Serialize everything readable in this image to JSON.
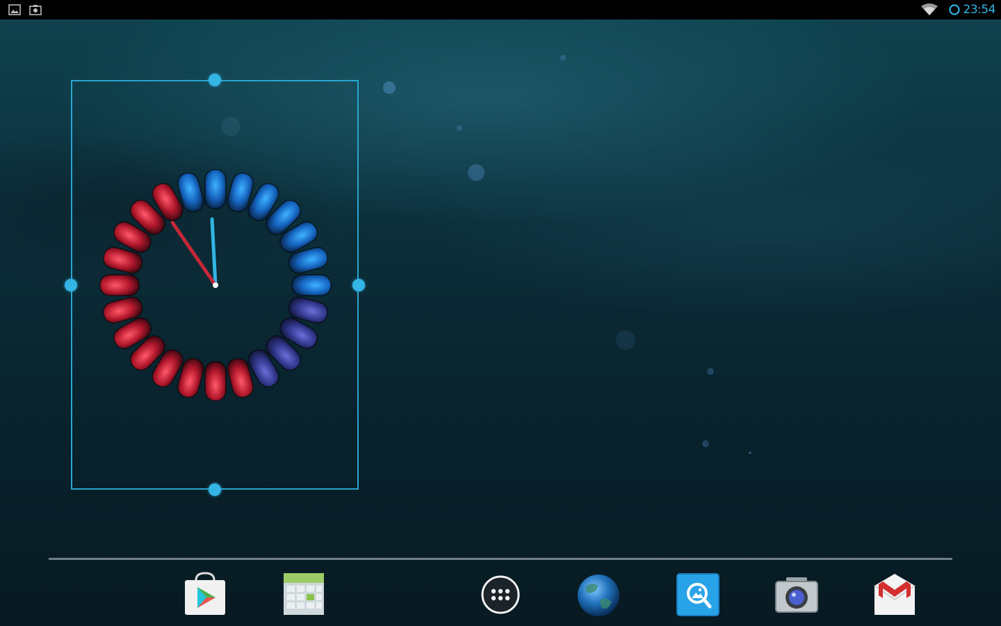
{
  "status_bar": {
    "time": "23:54",
    "notification_icons": [
      "gallery-notification-icon",
      "screenshot-notification-icon"
    ],
    "system_icons": [
      "wifi-icon",
      "sync-icon"
    ],
    "accent_color": "#33b5e5"
  },
  "widget": {
    "type": "analog-clock-widget",
    "selection_color": "#33b5e5",
    "ring_colors": {
      "top_right": "#1e88e5",
      "bottom_left": "#c62838"
    }
  },
  "dock": {
    "icons": [
      "play-store-icon",
      "calendar-app-icon",
      "app-drawer-icon",
      "browser-icon",
      "quickpic-gallery-icon",
      "camera-icon",
      "gmail-icon"
    ]
  }
}
